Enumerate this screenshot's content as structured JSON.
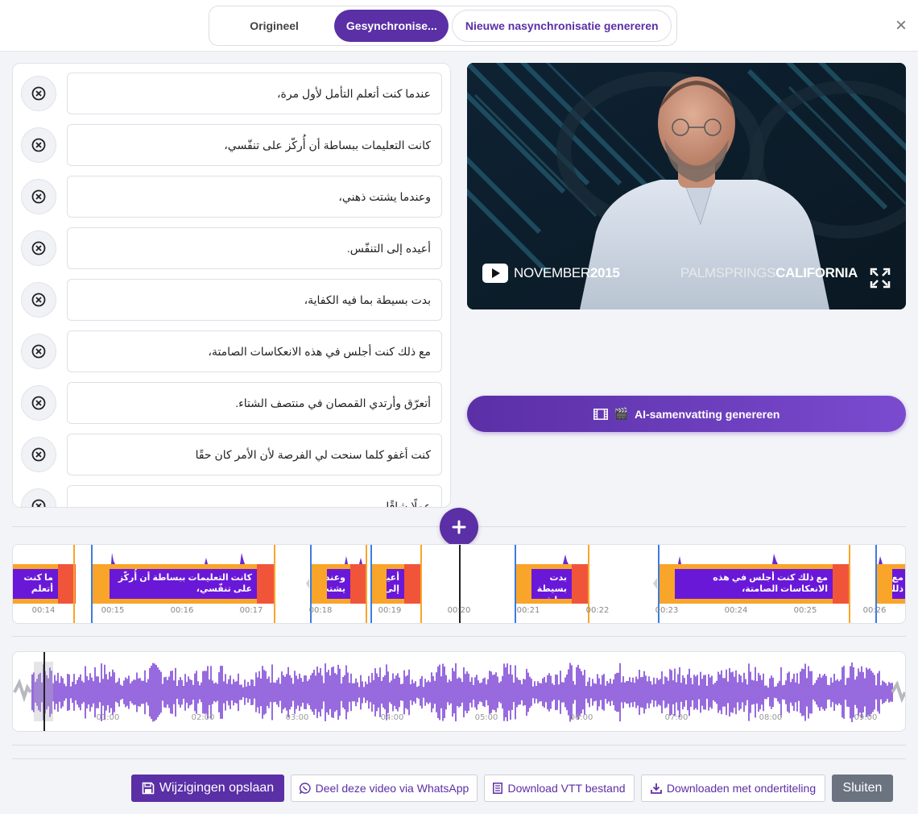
{
  "tabs": [
    {
      "label": "Origineel"
    },
    {
      "label": "Gesynchronise..."
    },
    {
      "label": "Nieuwe nasynchronisatie genereren"
    }
  ],
  "close_symbol": "×",
  "subtitles": [
    {
      "text": "عندما كنت أتعلم التأمل لأول مرة،"
    },
    {
      "text": "كانت التعليمات ببساطة أن أُركّز على تنفّسي،"
    },
    {
      "text": "وعندما يشتت ذهني،"
    },
    {
      "text": "أعيده إلى التنفّس."
    },
    {
      "text": "بدت بسيطة بما فيه الكفاية،"
    },
    {
      "text": "مع ذلك كنت أجلس في هذه الانعكاسات الصامتة،"
    },
    {
      "text": "أتعرّق وأرتدي القمصان في منتصف الشتاء."
    },
    {
      "text": "كنت أغفو كلما سنحت لي الفرصة لأن الأمر كان حقًا"
    },
    {
      "text": "عملًا شاقًا"
    }
  ],
  "video": {
    "month": "NOVEMBER",
    "year": "2015",
    "city": "PALMSPRINGS",
    "state": "CALIFORNIA"
  },
  "ai_button": {
    "icon": "film-icon",
    "emoji": "🎬",
    "label": "AI-samenvatting genereren"
  },
  "add_button": {
    "symbol": "+"
  },
  "timeline": {
    "ticks": [
      "00:14",
      "00:15",
      "00:16",
      "00:17",
      "00:18",
      "00:19",
      "00:20",
      "00:21",
      "00:22",
      "00:23",
      "00:24",
      "00:25",
      "00:26"
    ],
    "regions": [
      {
        "text": "ما كنت أتعلم"
      },
      {
        "text": "كانت التعليمات ببساطة أن أُركّز على تنفّسي،"
      },
      {
        "text": "وعندما يشتت"
      },
      {
        "text": "أعيده إلى"
      },
      {
        "text": "بدت بسيطة بما فيه الكفاية،"
      },
      {
        "text": "مع ذلك كنت أجلس في هذه الانعكاسات الصامتة،"
      },
      {
        "text": "مع ذلك"
      }
    ]
  },
  "overview": {
    "ticks": [
      "01:00",
      "02:00",
      "03:00",
      "04:00",
      "05:00",
      "06:00",
      "07:00",
      "08:00",
      "09:00"
    ]
  },
  "footer": {
    "save": {
      "icon": "floppy-icon",
      "label": "Wijzigingen opslaan"
    },
    "whatsapp": {
      "icon": "whatsapp-icon",
      "label": "Deel deze video via WhatsApp"
    },
    "vtt": {
      "icon": "document-icon",
      "label": "Download VTT bestand"
    },
    "download": {
      "icon": "download-icon",
      "label": "Downloaden met ondertiteling"
    },
    "close": {
      "label": "Sluiten"
    }
  },
  "colors": {
    "accent": "#5b2fa6",
    "region_orange": "#f8a52a",
    "region_handle": "#f0553a",
    "region_inner": "#6a18d8",
    "waveform": "#6a2bd0"
  }
}
